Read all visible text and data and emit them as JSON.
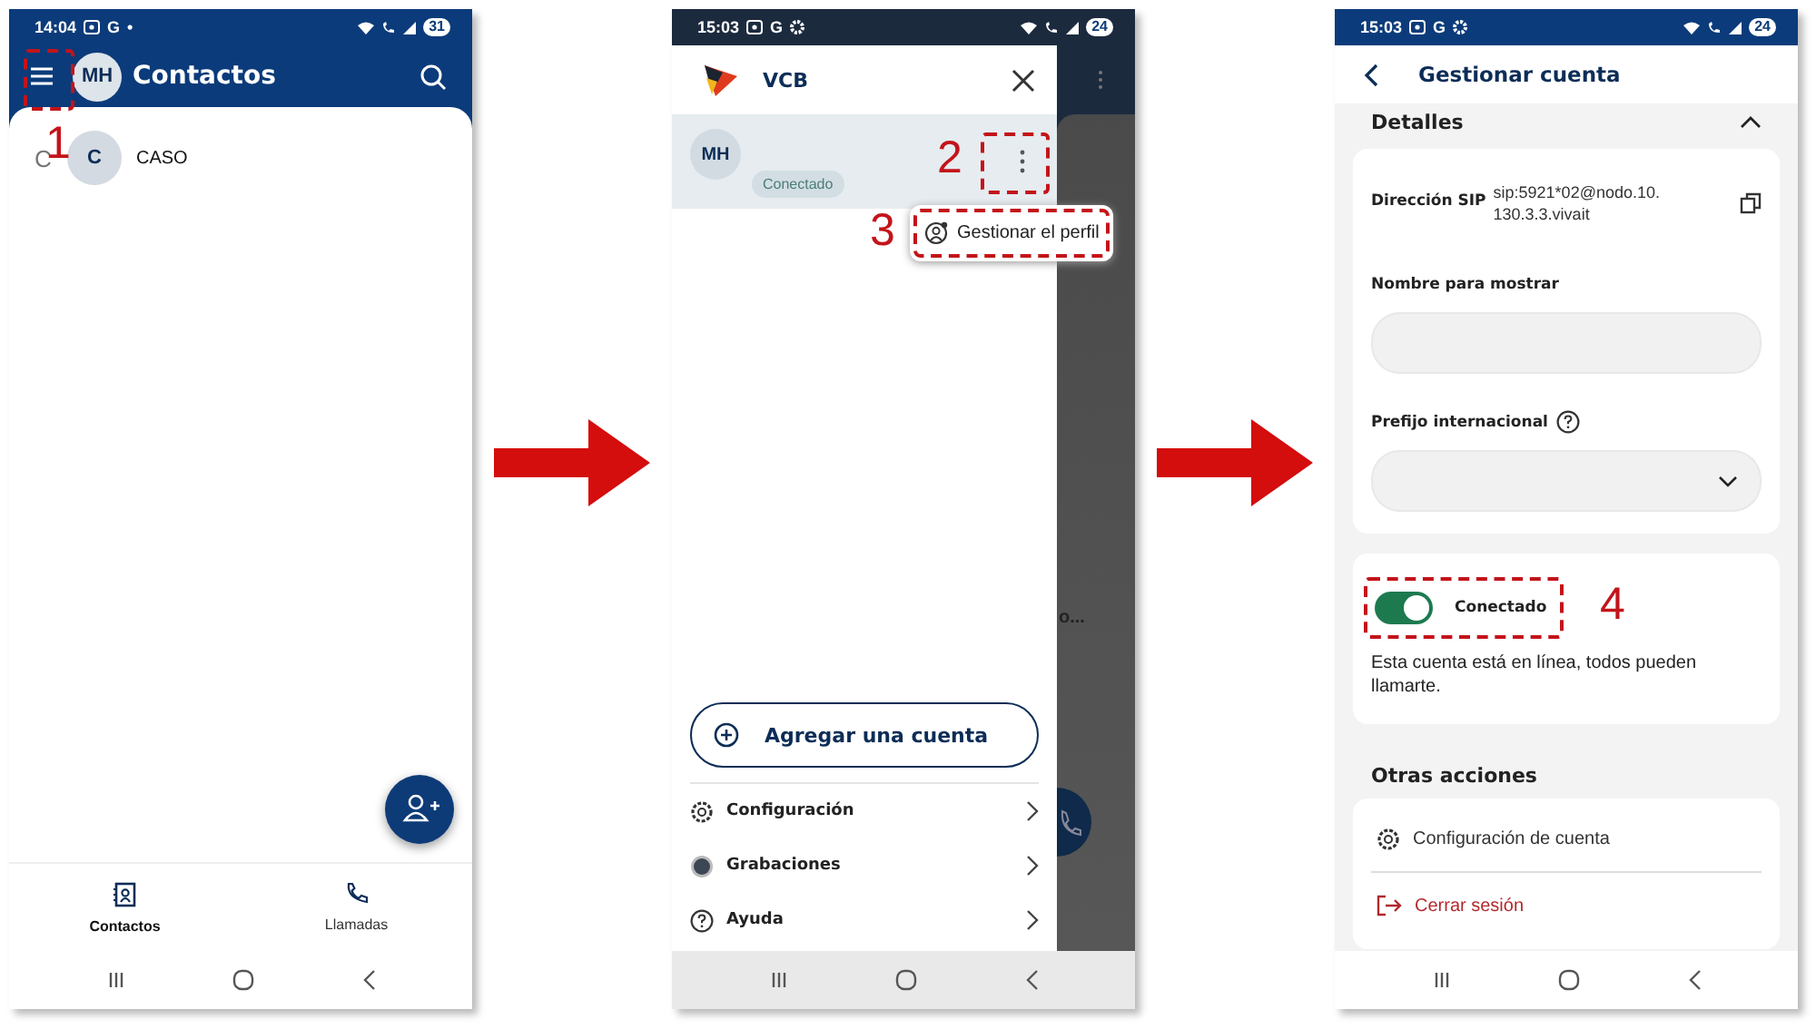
{
  "contacts_screen": {
    "status_bar": {
      "time": "14:04",
      "letter": "G",
      "dot": "•",
      "battery": "31"
    },
    "header": {
      "avatar": "MH",
      "title": "Contactos"
    },
    "step_number": "1",
    "section_letter": "C",
    "contacts": [
      {
        "initial": "C",
        "name": "CASO"
      }
    ],
    "bottom_nav": [
      {
        "kind": "contacts",
        "label": "Contactos",
        "selected": true
      },
      {
        "kind": "calls",
        "label": "Llamadas",
        "selected": false
      }
    ]
  },
  "drawer_screen": {
    "status_bar": {
      "time": "15:03",
      "letter": "G",
      "battery": "24"
    },
    "brand": "VCB",
    "account": {
      "avatar": "MH",
      "status": "Conectado"
    },
    "step_numbers": [
      "2",
      "3"
    ],
    "popup_item": "Gestionar el perfil",
    "add_button": "Agregar una cuenta",
    "background_text": "o...",
    "menu": [
      {
        "kind": "settings",
        "label": "Configuración"
      },
      {
        "kind": "recordings",
        "label": "Grabaciones"
      },
      {
        "kind": "help",
        "label": "Ayuda"
      }
    ]
  },
  "account_screen": {
    "status_bar": {
      "time": "15:03",
      "letter": "G",
      "battery": "24"
    },
    "title": "Gestionar cuenta",
    "section": "Detalles",
    "sip_label": "Dirección SIP",
    "sip_value": "sip:5921*02@nodo.10.130.3.3.vivait",
    "display_name_label": "Nombre para mostrar",
    "prefix_label": "Prefijo internacional",
    "status_toggle": {
      "label": "Conectado",
      "on": true
    },
    "step_number": "4",
    "status_note": "Esta cuenta está en línea, todos pueden llamarte.",
    "other_heading": "Otras acciones",
    "actions": [
      {
        "kind": "settings",
        "label": "Configuración de cuenta"
      },
      {
        "kind": "logout",
        "label": "Cerrar sesión"
      }
    ]
  }
}
